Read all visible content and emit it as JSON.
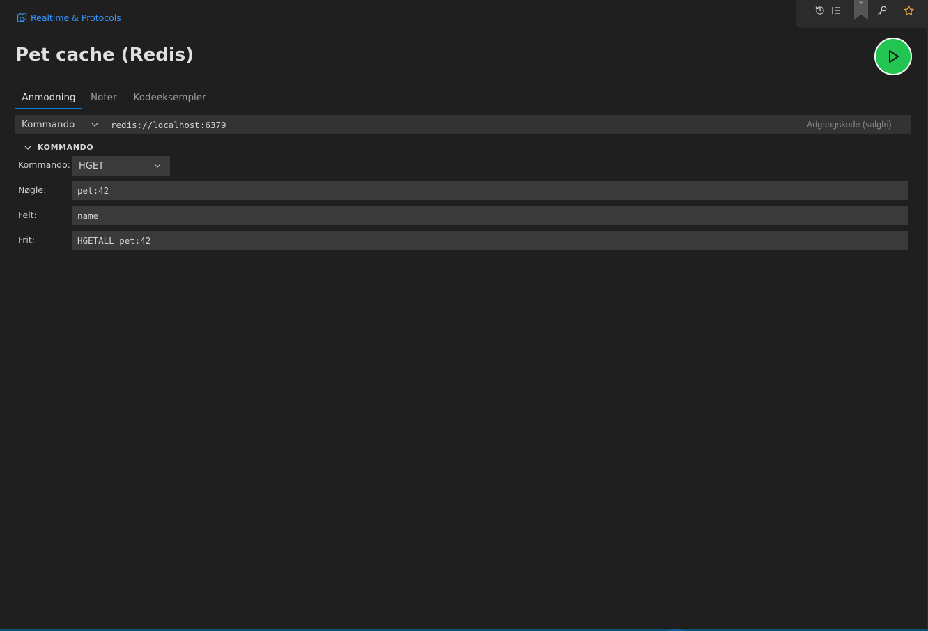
{
  "breadcrumb": {
    "label": "Realtime & Protocols",
    "icon": "collection-icon"
  },
  "toolbar": {
    "icons": [
      "history-icon",
      "list-icon",
      "bookmark-icon",
      "key-icon",
      "star-icon"
    ],
    "bookmark_plus": "+",
    "star_color": "#e8a33a"
  },
  "page": {
    "title": "Pet cache (Redis)"
  },
  "run": {
    "icon": "play-icon",
    "color": "#23c552"
  },
  "tabs": [
    {
      "label": "Anmodning",
      "active": true
    },
    {
      "label": "Noter",
      "active": false
    },
    {
      "label": "Kodeeksempler",
      "active": false
    }
  ],
  "connection": {
    "mode": "Kommando",
    "url": "redis://localhost:6379",
    "password_placeholder": "Adgangskode (valgfri)"
  },
  "section": {
    "title": "KOMMANDO"
  },
  "form": {
    "command_label": "Kommando:",
    "command_value": "HGET",
    "key_label": "Nøgle:",
    "key_value": "pet:42",
    "field_label": "Felt:",
    "field_value": "name",
    "free_label": "Frit:",
    "free_value": "HGETALL pet:42"
  },
  "colors": {
    "accent": "#0e7fd8",
    "link": "#3794ff",
    "background": "#1f1f1f"
  }
}
